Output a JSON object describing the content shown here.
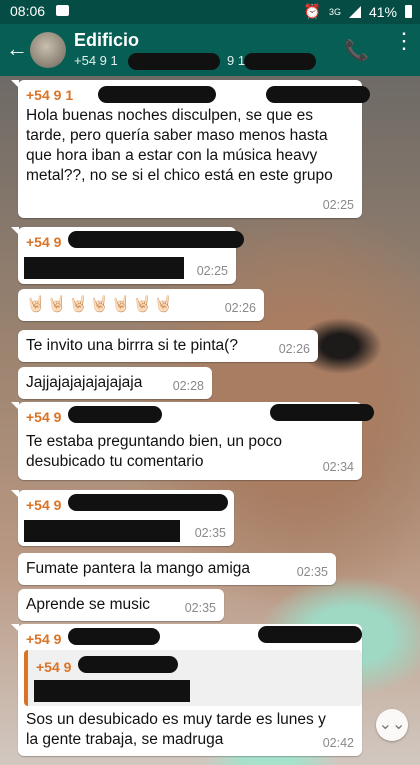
{
  "status": {
    "time": "08:06",
    "network": "3G",
    "battery": "41%"
  },
  "header": {
    "title": "Edificio",
    "subtitle_prefix": "+54 9 1",
    "subtitle_mid": "9 1"
  },
  "messages": [
    {
      "sender": "+54 9 1",
      "text": "Hola buenas noches disculpen, se que es tarde, pero quería saber maso menos hasta que hora iban a estar con  la música heavy metal??, no se si el chico está en este grupo",
      "time": "02:25"
    },
    {
      "sender": "+54 9",
      "text": "",
      "time": "02:25"
    },
    {
      "sender": "",
      "text": "🤘🏻🤘🏻🤘🏻🤘🏻🤘🏻🤘🏻🤘🏻",
      "time": "02:26"
    },
    {
      "sender": "",
      "text": "Te invito una birrra si te pinta(?",
      "time": "02:26"
    },
    {
      "sender": "",
      "text": "Jajjajajajajajajaja",
      "time": "02:28"
    },
    {
      "sender": "+54 9",
      "text": "Te estaba preguntando bien, un poco desubicado tu comentario",
      "time": "02:34"
    },
    {
      "sender": "+54 9",
      "text": "",
      "time": "02:35"
    },
    {
      "sender": "",
      "text": "Fumate pantera la mango amiga",
      "time": "02:35"
    },
    {
      "sender": "",
      "text": "Aprende se music",
      "time": "02:35"
    },
    {
      "sender": "+54 9",
      "quote_sender": "+54 9",
      "text": "Sos un desubicado es muy tarde es lunes y la gente trabaja, se madruga",
      "time": "02:42"
    }
  ]
}
